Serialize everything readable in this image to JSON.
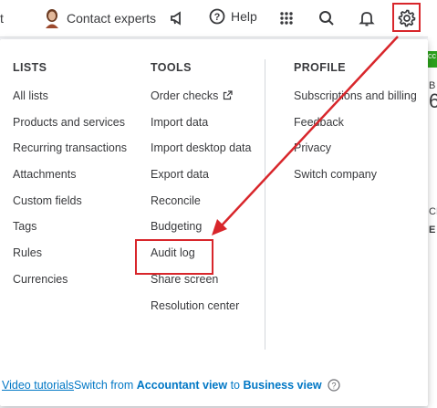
{
  "topbar": {
    "left_text": "t",
    "contact_label": "Contact experts",
    "help_label": "Help",
    "icons": [
      "avatar",
      "megaphone-icon",
      "help-circle-icon",
      "apps-grid-icon",
      "search-icon",
      "bell-icon",
      "gear-icon"
    ]
  },
  "background": {
    "green_badge": "cc",
    "chars": [
      "B",
      "6",
      "CL",
      "E"
    ]
  },
  "menu": {
    "lists": {
      "heading": "LISTS",
      "items": [
        "All lists",
        "Products and services",
        "Recurring transactions",
        "Attachments",
        "Custom fields",
        "Tags",
        "Rules",
        "Currencies"
      ]
    },
    "tools": {
      "heading": "TOOLS",
      "items": [
        "Order checks",
        "Import data",
        "Import desktop data",
        "Export data",
        "Reconcile",
        "Budgeting",
        "Audit log",
        "Share screen",
        "Resolution center"
      ]
    },
    "profile": {
      "heading": "PROFILE",
      "items": [
        "Subscriptions and billing",
        "Feedback",
        "Privacy",
        "Switch company"
      ]
    }
  },
  "footer": {
    "video_tutorials": "Video tutorials",
    "switch_prefix": "Switch from ",
    "switch_bold_1": "Accountant view",
    "switch_mid": " to ",
    "switch_bold_2": "Business view"
  },
  "colors": {
    "highlight": "#d8262b",
    "link": "#0077c5",
    "text": "#393a3d",
    "accent_green": "#2ca01c"
  }
}
